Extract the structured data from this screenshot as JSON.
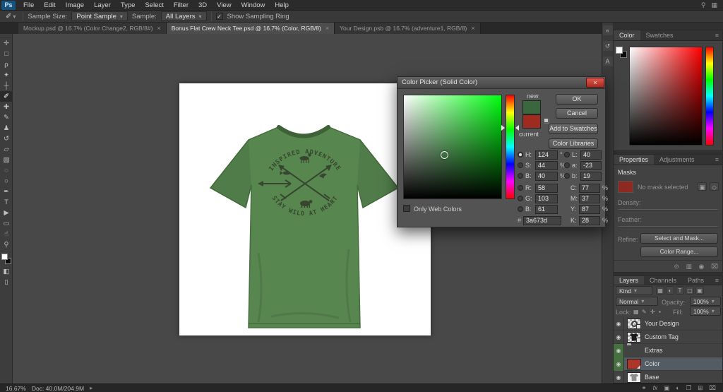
{
  "colors": {
    "new": "#3a673d",
    "current": "#9e2a20",
    "shirt": "#57864f",
    "design_ink": "#36462f",
    "layer_red": "#ab3629",
    "mask_red": "#8e2a21"
  },
  "menubar": {
    "logo": "Ps",
    "items": [
      "File",
      "Edit",
      "Image",
      "Layer",
      "Type",
      "Select",
      "Filter",
      "3D",
      "View",
      "Window",
      "Help"
    ]
  },
  "optionsbar": {
    "sample_size_label": "Sample Size:",
    "sample_size_value": "Point Sample",
    "sample_label": "Sample:",
    "sample_value": "All Layers",
    "sampling_ring_label": "Show Sampling Ring"
  },
  "tabs": [
    {
      "title": "Mockup.psd @ 16.7% (Color Change2, RGB/8#)"
    },
    {
      "title": "Bonus Flat Crew Neck Tee.psd @ 16.7% (Color, RGB/8)"
    },
    {
      "title": "Your Design.psb @ 16.7% (adventure1, RGB/8)"
    }
  ],
  "toolbar": {
    "tools": [
      {
        "name": "move",
        "glyph": "✛"
      },
      {
        "name": "rectangular-marquee",
        "glyph": "□"
      },
      {
        "name": "lasso",
        "glyph": "ρ"
      },
      {
        "name": "quick-selection",
        "glyph": "✦"
      },
      {
        "name": "crop",
        "glyph": "┼"
      },
      {
        "name": "eyedropper",
        "glyph": "✐"
      },
      {
        "name": "spot-healing-brush",
        "glyph": "✚"
      },
      {
        "name": "brush",
        "glyph": "✎"
      },
      {
        "name": "clone-stamp",
        "glyph": "♟"
      },
      {
        "name": "history-brush",
        "glyph": "↺"
      },
      {
        "name": "eraser",
        "glyph": "▱"
      },
      {
        "name": "gradient",
        "glyph": "▧"
      },
      {
        "name": "blur",
        "glyph": "◌"
      },
      {
        "name": "dodge",
        "glyph": "○"
      },
      {
        "name": "pen",
        "glyph": "✒"
      },
      {
        "name": "type",
        "glyph": "T"
      },
      {
        "name": "path-selection",
        "glyph": "▶"
      },
      {
        "name": "rectangle",
        "glyph": "▭"
      },
      {
        "name": "hand",
        "glyph": "☝"
      },
      {
        "name": "zoom",
        "glyph": "⚲"
      }
    ]
  },
  "artboard": {
    "arc_top": "INSPIRED ADVENTURE",
    "arc_bottom": "STAY WILD AT HEART"
  },
  "dialog": {
    "title": "Color Picker (Solid Color)",
    "new_label": "new",
    "current_label": "current",
    "ok": "OK",
    "cancel": "Cancel",
    "add_to_swatches": "Add to Swatches",
    "color_libraries": "Color Libraries",
    "only_web_label": "Only Web Colors",
    "hex_prefix": "#",
    "hex_value": "3a673d",
    "fields": {
      "H": {
        "label": "H:",
        "value": "124",
        "unit": "°"
      },
      "S": {
        "label": "S:",
        "value": "44",
        "unit": "%"
      },
      "B": {
        "label": "B:",
        "value": "40",
        "unit": "%"
      },
      "R": {
        "label": "R:",
        "value": "58",
        "unit": ""
      },
      "G": {
        "label": "G:",
        "value": "103",
        "unit": ""
      },
      "B2": {
        "label": "B:",
        "value": "61",
        "unit": ""
      },
      "L": {
        "label": "L:",
        "value": "40",
        "unit": ""
      },
      "a": {
        "label": "a:",
        "value": "-23",
        "unit": ""
      },
      "b": {
        "label": "b:",
        "value": "19",
        "unit": ""
      },
      "C": {
        "label": "C:",
        "value": "77",
        "unit": "%"
      },
      "M": {
        "label": "M:",
        "value": "37",
        "unit": "%"
      },
      "Y": {
        "label": "Y:",
        "value": "87",
        "unit": "%"
      },
      "K": {
        "label": "K:",
        "value": "28",
        "unit": "%"
      }
    }
  },
  "color_panel": {
    "tab_color": "Color",
    "tab_swatches": "Swatches"
  },
  "properties_panel": {
    "tab_properties": "Properties",
    "tab_adjustments": "Adjustments",
    "masks_title": "Masks",
    "no_mask_text": "No mask selected",
    "density_label": "Density:",
    "feather_label": "Feather:",
    "refine_label": "Refine:",
    "select_mask_btn": "Select and Mask...",
    "color_range_btn": "Color Range..."
  },
  "layers_panel": {
    "tab_layers": "Layers",
    "tab_channels": "Channels",
    "tab_paths": "Paths",
    "kind_label": "Kind",
    "blend_mode": "Normal",
    "opacity_label": "Opacity:",
    "opacity_value": "100%",
    "lock_label": "Lock:",
    "fill_label": "Fill:",
    "fill_value": "100%",
    "layers": [
      {
        "name": "Your Design"
      },
      {
        "name": "Custom Tag"
      },
      {
        "name": "Extras"
      },
      {
        "name": "Color"
      },
      {
        "name": "Base"
      }
    ]
  },
  "statusbar": {
    "zoom": "16.67%",
    "doc": "Doc: 40.0M/204.9M"
  },
  "glyphs": {
    "chevron_down": "▾",
    "close": "×",
    "check": "✓",
    "eye": "◉",
    "panel_menu": "≡",
    "collapse_right": "«",
    "history": "↺",
    "workspace": "▦",
    "search": "⚲",
    "character": "A",
    "quick_mask": "◧",
    "screen_mode": "▯",
    "filter_pixel": "▦",
    "filter_adjust": "◐",
    "filter_type": "T",
    "filter_shape": "▢",
    "filter_smart": "▣",
    "lock_checker": "▦",
    "lock_brush": "✎",
    "lock_move": "✛",
    "lock_all": "▪",
    "link": "⚭",
    "fx": "fx",
    "adjust_icon": "◐",
    "mask_icon": "▣",
    "vector_icon": "◇",
    "group_icon": "❐",
    "new_layer": "⊞",
    "trash": "⌧",
    "load_selection": "⊙",
    "apply_mask": "▥",
    "arrow_small": "▸"
  }
}
